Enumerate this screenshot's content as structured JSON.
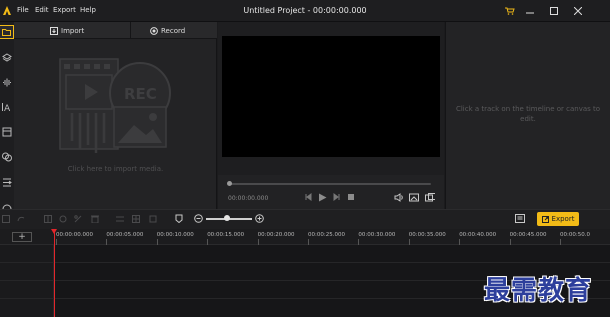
{
  "window": {
    "title": "Untitled Project - 00:00:00.000",
    "menu": [
      "File",
      "Edit",
      "Export",
      "Help"
    ]
  },
  "media_panel": {
    "tabs": [
      {
        "label": "Import",
        "icon": "import-icon"
      },
      {
        "label": "Record",
        "icon": "record-icon"
      }
    ],
    "placeholder_text": "Click here to import media.",
    "placeholder_badge": "REC"
  },
  "preview": {
    "timecode": "00:00:00.000",
    "progress_fraction": 0.0
  },
  "properties": {
    "hint": "Click a track on the timeline or canvas to edit."
  },
  "timeline": {
    "export_label": "Export",
    "zoom_fraction": 0.45,
    "ruler": [
      "00:00:00.000",
      "00:00:05.000",
      "00:00:10.000",
      "00:00:15.000",
      "00:00:20.000",
      "00:00:25.000",
      "00:00:30.000",
      "00:00:35.000",
      "00:00:40.000",
      "00:00:45.000",
      "00:00:50.0"
    ]
  },
  "watermark": "最需教育",
  "colors": {
    "accent": "#f2bb17",
    "playhead": "#e3262b",
    "background": "#1b1b1d"
  }
}
